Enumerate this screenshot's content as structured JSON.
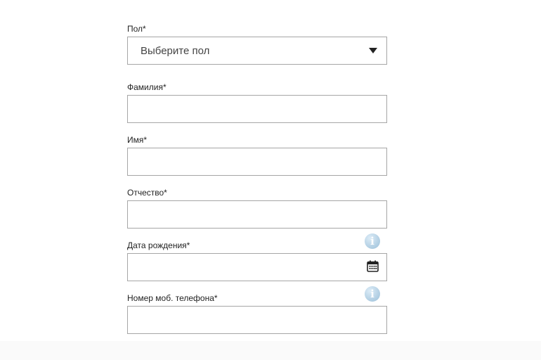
{
  "form": {
    "gender": {
      "label": "Пол*",
      "placeholder": "Выберите пол"
    },
    "last_name": {
      "label": "Фамилия*",
      "value": ""
    },
    "first_name": {
      "label": "Имя*",
      "value": ""
    },
    "patronymic": {
      "label": "Отчество*",
      "value": ""
    },
    "birth_date": {
      "label": "Дата рождения*",
      "value": "",
      "info_icon": "info-icon",
      "calendar_icon": "calendar-icon"
    },
    "phone": {
      "label": "Номер моб. телефона*",
      "value": "",
      "info_icon": "info-icon"
    }
  },
  "colors": {
    "border": "#a6a6a6",
    "text": "#222222",
    "info_icon": "#b8d3e6"
  },
  "glyphs": {
    "info": "i"
  }
}
